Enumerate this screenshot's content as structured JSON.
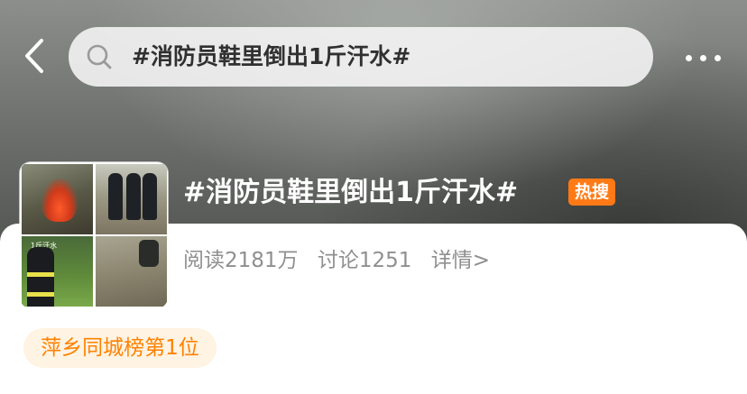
{
  "header": {
    "search_query": "#消防员鞋里倒出1斤汗水#"
  },
  "icons": {
    "back": "chevron-left-icon",
    "search": "search-icon",
    "more": "more-horizontal-icon"
  },
  "topic": {
    "title": "#消防员鞋里倒出1斤汗水#",
    "hot_badge": "热搜",
    "reads_label": "阅读2181万",
    "discussions_label": "讨论1251",
    "detail_link": "详情>",
    "rank_label": "萍乡同城榜第1位"
  },
  "thumbnail": {
    "caption": "1斤汗水"
  },
  "colors": {
    "hot_badge": "#ff7a16",
    "rank_text": "#ff8200",
    "rank_bg": "#fff3e3",
    "stats_text": "#8f8f8f"
  }
}
